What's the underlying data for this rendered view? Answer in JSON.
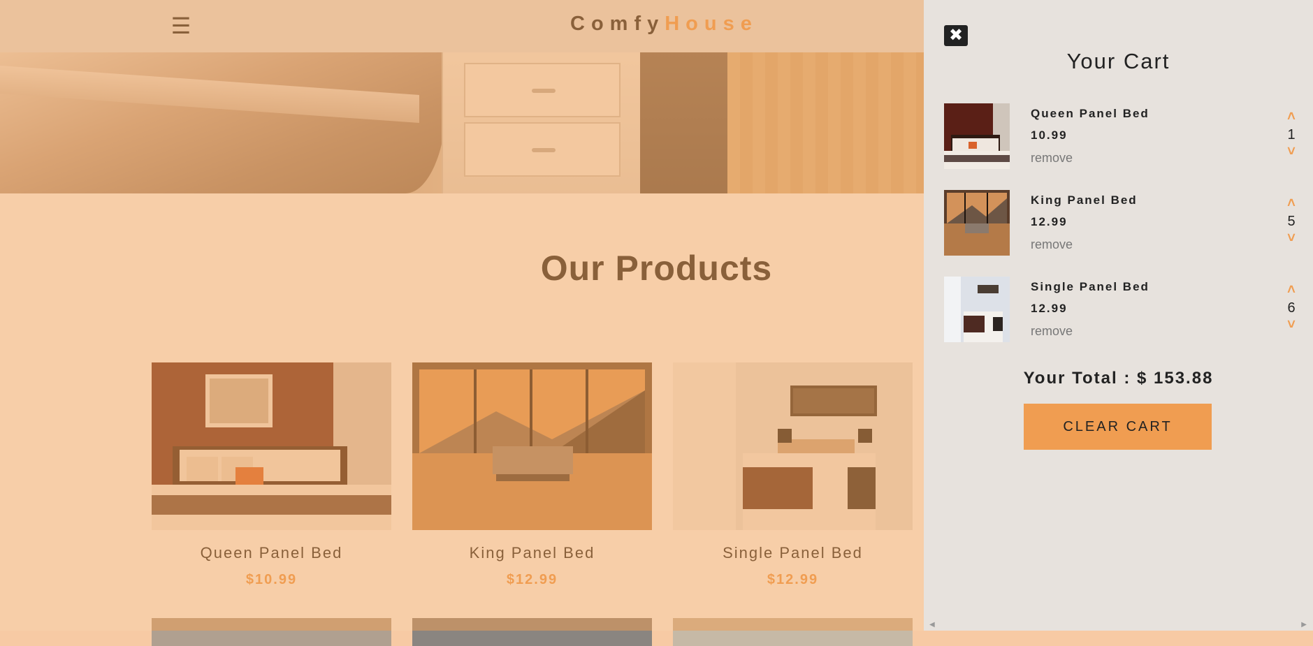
{
  "navbar": {
    "menu_icon": "hamburger-menu-icon",
    "logo_part1": "Comfy",
    "logo_part2": "House"
  },
  "products_section": {
    "title": "Our Products",
    "items": [
      {
        "name": "Queen Panel Bed",
        "price": "$10.99"
      },
      {
        "name": "King Panel Bed",
        "price": "$12.99"
      },
      {
        "name": "Single Panel Bed",
        "price": "$12.99"
      }
    ]
  },
  "cart": {
    "close_icon": "close-icon",
    "title": "Your Cart",
    "items": [
      {
        "name": "Queen Panel Bed",
        "price": "10.99",
        "remove": "remove",
        "qty": "1"
      },
      {
        "name": "King Panel Bed",
        "price": "12.99",
        "remove": "remove",
        "qty": "5"
      },
      {
        "name": "Single Panel Bed",
        "price": "12.99",
        "remove": "remove",
        "qty": "6"
      }
    ],
    "total_label": "Your Total : $ ",
    "total_value": "153.88",
    "clear_label": "CLEAR CART"
  },
  "colors": {
    "accent": "#f09d51",
    "overlay": "rgba(240,157,81,0.5)",
    "cart_bg": "#e7e2dd",
    "text": "#222222"
  }
}
